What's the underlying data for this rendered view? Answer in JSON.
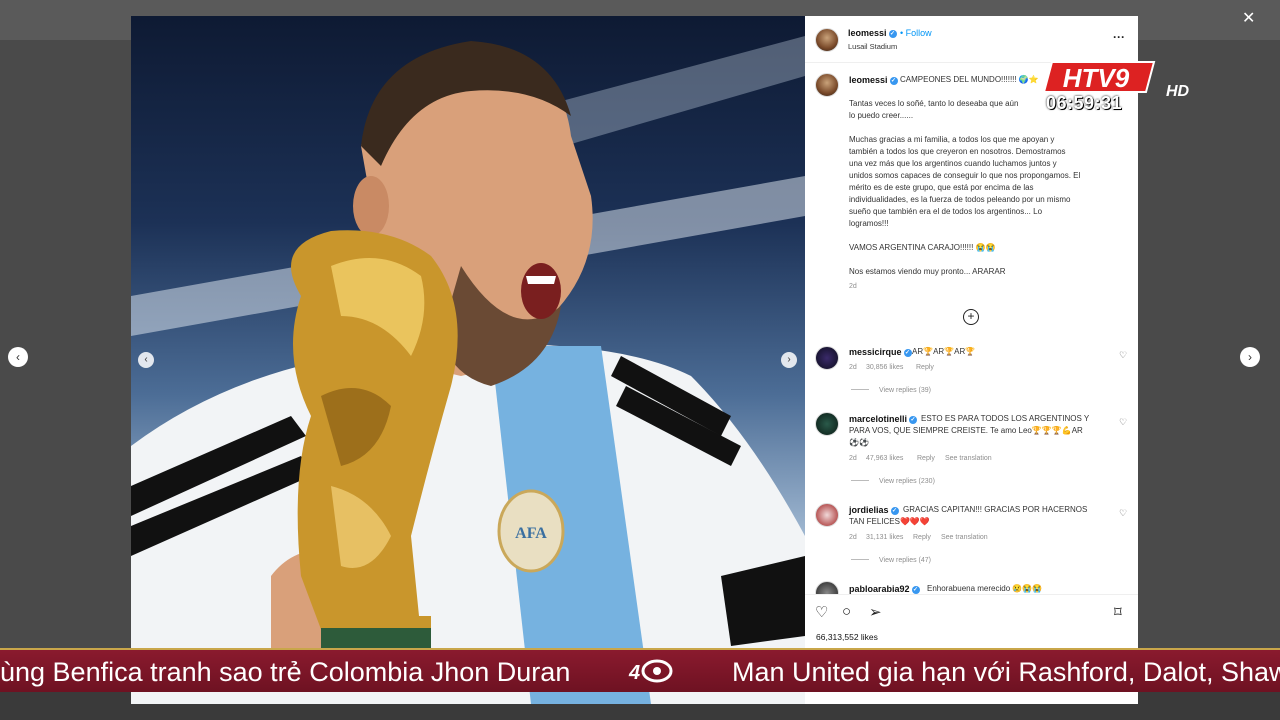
{
  "post": {
    "username": "leomessi",
    "follow_label": "Follow",
    "location": "Lusail Stadium",
    "caption_title": "CAMPEONES DEL MUNDO!!!!!!! 🌍⭐",
    "caption_p1_l1": "Tantas veces lo soñé, tanto lo deseaba que aún",
    "caption_p1_l2": "lo puedo creer......",
    "caption_p2": [
      "Muchas gracias a mi familia, a todos los que me apoyan y",
      "también a todos los que creyeron en nosotros. Demostramos",
      "una vez más que los argentinos cuando luchamos juntos y",
      "unidos somos capaces de conseguir lo que nos propongamos. El",
      "mérito es de este grupo, que está por encima de las",
      "individualidades, es la fuerza de todos peleando por un mismo",
      "sueño que también era el de todos los argentinos... Lo",
      "logramos!!!"
    ],
    "caption_p3": "VAMOS ARGENTINA CARAJO!!!!!! 😭😭",
    "caption_p4": "Nos estamos viendo muy pronto... ARARAR",
    "time": "2d",
    "likes": "66,313,552 likes"
  },
  "comments": [
    {
      "user": "messicirque",
      "text": "AR🏆AR🏆AR🏆",
      "time": "2d",
      "likes": "30,856 likes",
      "reply": "Reply",
      "translate": "",
      "replies": "View replies (39)"
    },
    {
      "user": "marcelotinelli",
      "text_l1": "ESTO ES PARA TODOS LOS ARGENTINOS Y",
      "text_l2": "PARA VOS, QUE SIEMPRE CREISTE. Te amo Leo🏆🏆🏆💪AR",
      "text_l3": "⚽⚽",
      "time": "2d",
      "likes": "47,963 likes",
      "reply": "Reply",
      "translate": "See translation",
      "replies": "View replies (230)"
    },
    {
      "user": "jordielias",
      "text_l1": "GRACIAS CAPITAN!!! GRACIAS POR HACERNOS",
      "text_l2": "TAN FELICES❤️❤️❤️",
      "time": "2d",
      "likes": "31,131 likes",
      "reply": "Reply",
      "translate": "See translation",
      "replies": "View replies (47)"
    },
    {
      "user": "pabloarabia92",
      "text": "Enhorabuena merecido 😢😭😭"
    }
  ],
  "overlay": {
    "channel": "HTV9",
    "channel_suffix": "HD",
    "clock": "06:59:31"
  },
  "ticker": {
    "item1": "ùng Benfica tranh sao trẻ Colombia Jhon Duran",
    "item2": "Man United gia hạn với Rashford, Dalot, Shaw"
  },
  "colors": {
    "ticker_bg": "#7a1628",
    "accent": "#0095f6"
  }
}
